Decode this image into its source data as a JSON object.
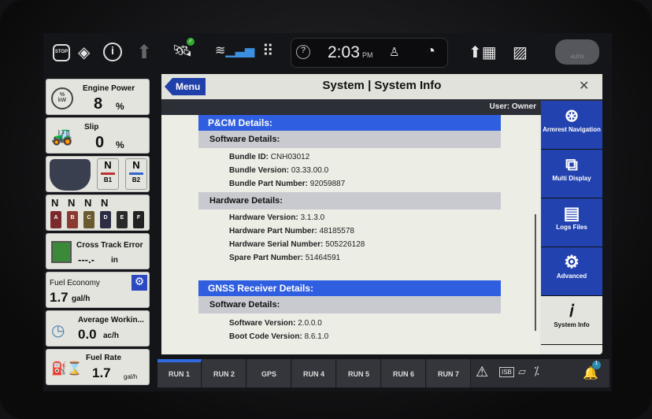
{
  "topbar": {
    "time": "2:03",
    "ampm": "PM",
    "auto_label": "AUTO",
    "icons": [
      "stop-icon",
      "warning-icon",
      "info-icon",
      "up-arrow-icon",
      "satellite-icon",
      "wifi-icon",
      "grid-menu-icon",
      "help-icon",
      "user-icon",
      "speedometer-icon",
      "rate-up-icon",
      "field-icon",
      "auto-steer-icon"
    ]
  },
  "tiles": {
    "engine_power": {
      "label": "Engine Power",
      "value": "8",
      "unit": "%",
      "icon_text": "% kW"
    },
    "slip": {
      "label": "Slip",
      "value": "0",
      "unit": "%"
    },
    "hitch": {
      "b1_state": "N",
      "b1_label": "B1",
      "b2_state": "N",
      "b2_label": "B2"
    },
    "remotes": {
      "states": [
        "N",
        "N",
        "N",
        "N"
      ],
      "labels": [
        "A",
        "B",
        "C",
        "D",
        "E",
        "F"
      ],
      "colors": [
        "#7a2a2a",
        "#8a3a30",
        "#6a5a30",
        "#2c2c44",
        "#2a2a2a",
        "#222"
      ]
    },
    "cross_track": {
      "label": "Cross Track Error",
      "value": "---.-",
      "unit": "in"
    },
    "fuel_economy": {
      "label": "Fuel Economy",
      "value": "1.7",
      "unit": "gal/h"
    },
    "avg_working": {
      "label": "Average Workin...",
      "value": "0.0",
      "unit": "ac/h"
    },
    "fuel_rate": {
      "label": "Fuel Rate",
      "value": "1.7",
      "unit": "gal/h"
    }
  },
  "panel": {
    "menu_label": "Menu",
    "title": "System | System Info",
    "close": "✕",
    "user": "User: Owner"
  },
  "content": {
    "pcm_title": "P&CM Details:",
    "software_title": "Software Details:",
    "software_rows": [
      {
        "k": "Bundle ID:",
        "v": "CNH03012"
      },
      {
        "k": "Bundle Version:",
        "v": "03.33.00.0"
      },
      {
        "k": "Bundle Part Number:",
        "v": "92059887"
      }
    ],
    "hardware_title": "Hardware Details:",
    "hardware_rows": [
      {
        "k": "Hardware Version:",
        "v": "3.1.3.0"
      },
      {
        "k": "Hardware Part Number:",
        "v": "48185578"
      },
      {
        "k": "Hardware Serial Number:",
        "v": "505226128"
      },
      {
        "k": "Spare Part Number:",
        "v": "51464591"
      }
    ],
    "gnss_title": "GNSS Receiver Details:",
    "gnss_software_title": "Software Details:",
    "gnss_rows": [
      {
        "k": "Software Version:",
        "v": "2.0.0.0"
      },
      {
        "k": "Boot Code Version:",
        "v": "8.6.1.0"
      }
    ]
  },
  "nav": [
    {
      "label": "Armrest Navigation",
      "icon": "armrest-icon"
    },
    {
      "label": "Multi Display",
      "icon": "multi-display-icon"
    },
    {
      "label": "Logs Files",
      "icon": "logs-icon"
    },
    {
      "label": "Advanced",
      "icon": "gears-icon"
    },
    {
      "label": "System Info",
      "icon": "info-icon",
      "active": true
    }
  ],
  "tabs": [
    "RUN 1",
    "RUN 2",
    "GPS",
    "RUN 4",
    "RUN 5",
    "RUN 6",
    "RUN 7"
  ],
  "active_tab": 0,
  "status": {
    "isb_label": "ISB",
    "notification_count": "1"
  },
  "colors": {
    "accent": "#2f5ee0",
    "nav": "#2242b0"
  }
}
